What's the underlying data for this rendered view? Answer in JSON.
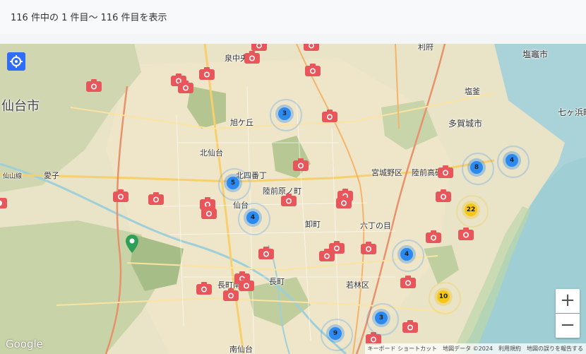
{
  "header": {
    "result_text": "116 件中の 1 件目〜 116 件目を表示"
  },
  "map": {
    "places": [
      {
        "name": "place-sendai-city",
        "text": "仙台市"
      },
      {
        "name": "place-izumi-chuo",
        "text": "泉中央"
      },
      {
        "name": "place-rifu",
        "text": "利府"
      },
      {
        "name": "place-shiogama-city",
        "text": "塩竈市"
      },
      {
        "name": "place-shiogama",
        "text": "塩釜"
      },
      {
        "name": "place-nanagahama",
        "text": "七ヶ浜町"
      },
      {
        "name": "place-tagajo-city",
        "text": "多賀城市"
      },
      {
        "name": "place-asahigaoka",
        "text": "旭ケ丘"
      },
      {
        "name": "place-kitasendai",
        "text": "北仙台"
      },
      {
        "name": "place-atago",
        "text": "愛子"
      },
      {
        "name": "place-senzan-line",
        "text": "仙山線"
      },
      {
        "name": "place-kita-yonbancho",
        "text": "北四番丁"
      },
      {
        "name": "place-rikuzen-haranomachi",
        "text": "陸前原ノ町"
      },
      {
        "name": "place-miyaginono-ku",
        "text": "宮城野区"
      },
      {
        "name": "place-rikuzen-takasago",
        "text": "陸前高砂"
      },
      {
        "name": "place-sendai",
        "text": "仙台"
      },
      {
        "name": "place-oroshimachi",
        "text": "卸町"
      },
      {
        "name": "place-rokuchonome",
        "text": "六丁の目"
      },
      {
        "name": "place-wakabayashi-ku",
        "text": "若林区"
      },
      {
        "name": "place-nagamachi-minami",
        "text": "長町南"
      },
      {
        "name": "place-nagamachi",
        "text": "長町"
      },
      {
        "name": "place-minami-sendai",
        "text": "南仙台"
      }
    ],
    "clusters": [
      {
        "count": "3",
        "color": "#2a8af2"
      },
      {
        "count": "5",
        "color": "#2a8af2"
      },
      {
        "count": "4",
        "color": "#2a8af2"
      },
      {
        "count": "8",
        "color": "#2a8af2"
      },
      {
        "count": "4",
        "color": "#2a8af2"
      },
      {
        "count": "22",
        "color": "#f5c518"
      },
      {
        "count": "4",
        "color": "#2a8af2"
      },
      {
        "count": "10",
        "color": "#f5c518"
      },
      {
        "count": "3",
        "color": "#2a8af2"
      },
      {
        "count": "9",
        "color": "#2a8af2"
      }
    ],
    "camera_marker_color": "#e8555a",
    "controls": {
      "zoom_in": "+",
      "zoom_out": "−"
    },
    "logo": "Google",
    "attribution": {
      "shortcuts": "キーボード ショートカット",
      "map_data": "地図データ ©2024",
      "terms": "利用規約",
      "report": "地図の誤りを報告する"
    }
  }
}
